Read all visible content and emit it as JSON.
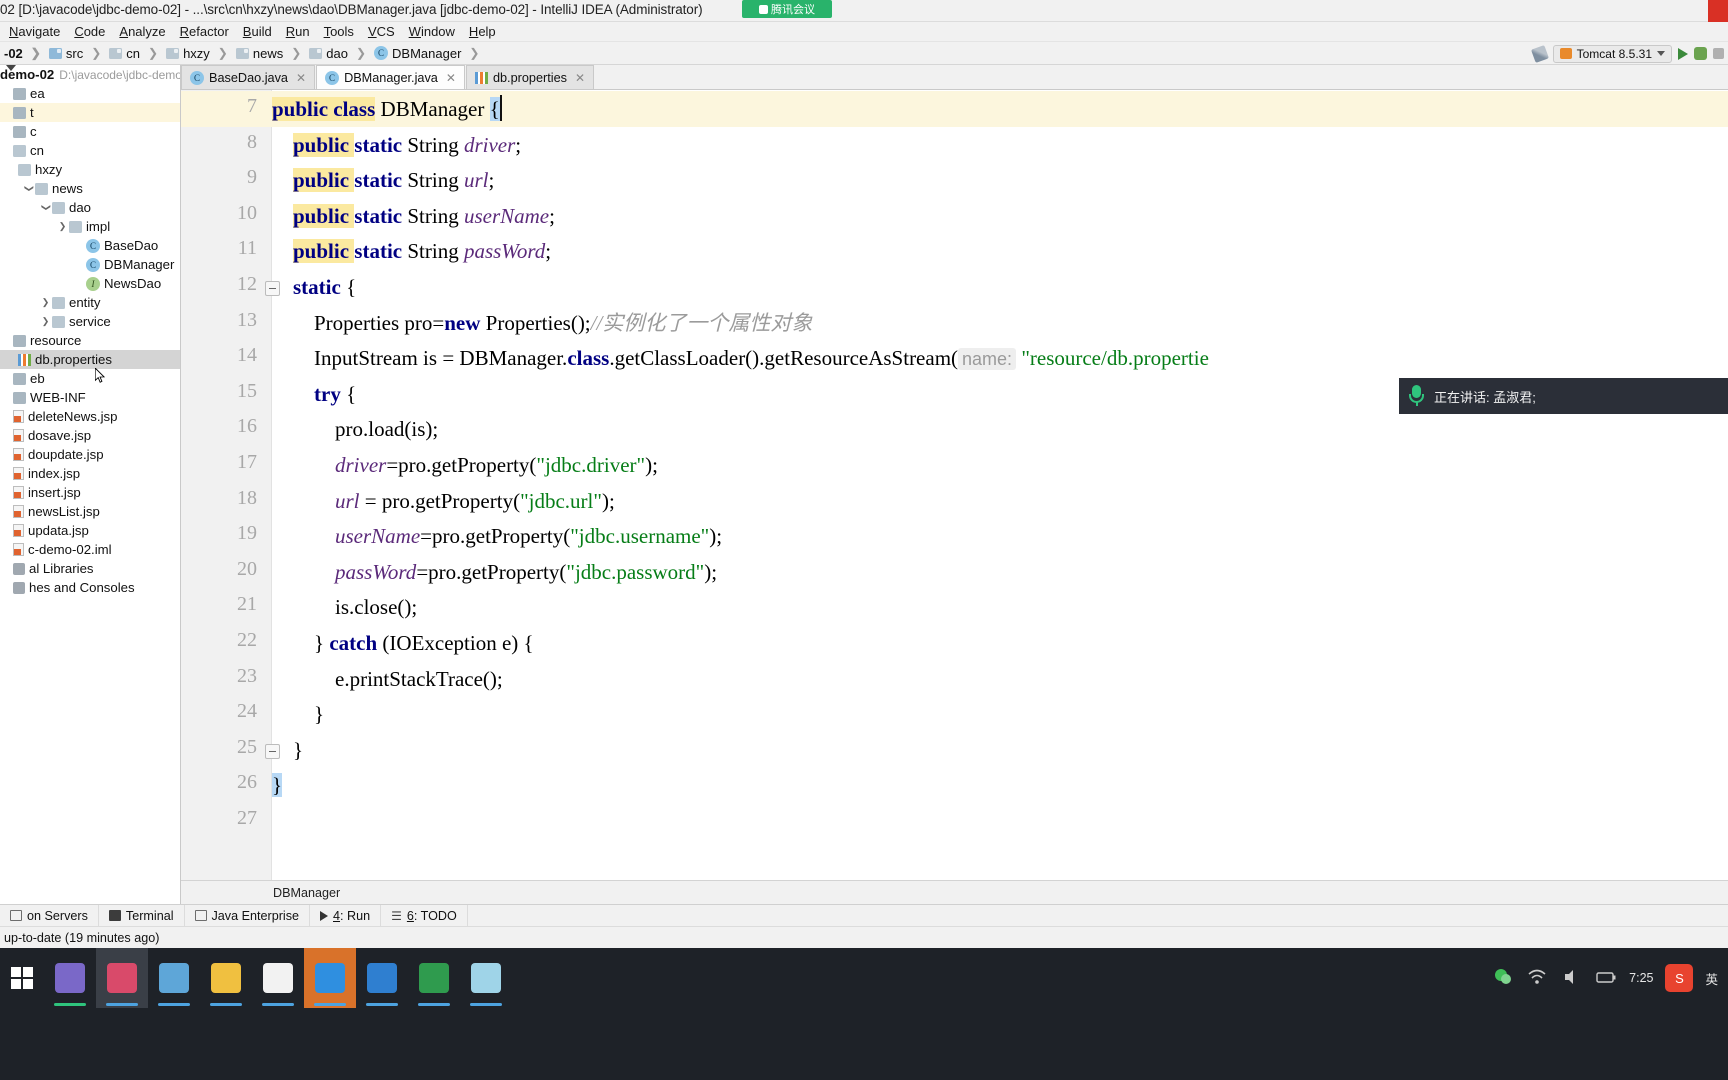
{
  "window": {
    "title": "02 [D:\\javacode\\jdbc-demo-02] - ...\\src\\cn\\hxzy\\news\\dao\\DBManager.java [jdbc-demo-02] - IntelliJ IDEA (Administrator)",
    "meeting_badge": "腾讯会议"
  },
  "menu": {
    "items": [
      "Navigate",
      "Code",
      "Analyze",
      "Refactor",
      "Build",
      "Run",
      "Tools",
      "VCS",
      "Window",
      "Help"
    ]
  },
  "breadcrumb": {
    "items": [
      {
        "label": "-02",
        "icon": "module-icon"
      },
      {
        "label": "src",
        "icon": "folder-icon"
      },
      {
        "label": "cn",
        "icon": "folder-icon"
      },
      {
        "label": "hxzy",
        "icon": "folder-icon"
      },
      {
        "label": "news",
        "icon": "folder-icon"
      },
      {
        "label": "dao",
        "icon": "folder-icon"
      },
      {
        "label": "DBManager",
        "icon": "class-icon"
      }
    ]
  },
  "run_toolbar": {
    "config_name": "Tomcat 8.5.31",
    "run_icon": "run-play-icon",
    "debug_icon": "debug-bug-icon",
    "build_icon": "build-hammer-icon",
    "stop_icon": "stop-icon",
    "search_icon": "search-everywhere-icon"
  },
  "project_tool": {
    "title_icons": [
      "locate-icon",
      "collapse-all-icon",
      "settings-gear-icon",
      "minimize-icon"
    ],
    "root": {
      "name": "demo-02",
      "path": "D:\\javacode\\jdbc-demo-"
    },
    "tree": [
      {
        "label": "ea",
        "depth": 0,
        "icon": "folder-icon",
        "twisty": "",
        "state": "none"
      },
      {
        "label": "t",
        "depth": 0,
        "icon": "folder-icon",
        "twisty": "",
        "state": "highlight"
      },
      {
        "label": "c",
        "depth": 0,
        "icon": "folder-icon",
        "twisty": "",
        "state": "none"
      },
      {
        "label": "cn",
        "depth": 0,
        "icon": "package-icon",
        "twisty": "",
        "state": "none"
      },
      {
        "label": "hxzy",
        "depth": 1,
        "icon": "package-icon",
        "twisty": "",
        "state": "none"
      },
      {
        "label": "news",
        "depth": 2,
        "icon": "package-icon",
        "twisty": "down",
        "state": "none"
      },
      {
        "label": "dao",
        "depth": 3,
        "icon": "package-icon",
        "twisty": "down",
        "state": "none"
      },
      {
        "label": "impl",
        "depth": 4,
        "icon": "package-icon",
        "twisty": "right",
        "state": "none"
      },
      {
        "label": "BaseDao",
        "depth": 5,
        "icon": "class-icon",
        "twisty": "",
        "state": "none"
      },
      {
        "label": "DBManager",
        "depth": 5,
        "icon": "class-icon",
        "twisty": "",
        "state": "none"
      },
      {
        "label": "NewsDao",
        "depth": 5,
        "icon": "interface-icon",
        "twisty": "",
        "state": "none"
      },
      {
        "label": "entity",
        "depth": 3,
        "icon": "package-icon",
        "twisty": "right",
        "state": "none"
      },
      {
        "label": "service",
        "depth": 3,
        "icon": "package-icon",
        "twisty": "right",
        "state": "none"
      },
      {
        "label": "resource",
        "depth": 0,
        "icon": "resource-icon",
        "twisty": "",
        "state": "none"
      },
      {
        "label": "db.properties",
        "depth": 1,
        "icon": "properties-icon",
        "twisty": "",
        "state": "selected"
      },
      {
        "label": "eb",
        "depth": 0,
        "icon": "folder-icon",
        "twisty": "",
        "state": "none"
      },
      {
        "label": "WEB-INF",
        "depth": 0,
        "icon": "folder-icon",
        "twisty": "",
        "state": "none"
      },
      {
        "label": "deleteNews.jsp",
        "depth": 0,
        "icon": "jsp-icon",
        "twisty": "",
        "state": "none"
      },
      {
        "label": "dosave.jsp",
        "depth": 0,
        "icon": "jsp-icon",
        "twisty": "",
        "state": "none"
      },
      {
        "label": "doupdate.jsp",
        "depth": 0,
        "icon": "jsp-icon",
        "twisty": "",
        "state": "none"
      },
      {
        "label": "index.jsp",
        "depth": 0,
        "icon": "jsp-icon",
        "twisty": "",
        "state": "none"
      },
      {
        "label": "insert.jsp",
        "depth": 0,
        "icon": "jsp-icon",
        "twisty": "",
        "state": "none"
      },
      {
        "label": "newsList.jsp",
        "depth": 0,
        "icon": "jsp-icon",
        "twisty": "",
        "state": "none"
      },
      {
        "label": "updata.jsp",
        "depth": 0,
        "icon": "jsp-icon",
        "twisty": "",
        "state": "none"
      },
      {
        "label": "c-demo-02.iml",
        "depth": 0,
        "icon": "iml-icon",
        "twisty": "",
        "state": "none"
      },
      {
        "label": "al Libraries",
        "depth": 0,
        "icon": "library-icon",
        "twisty": "",
        "state": "none"
      },
      {
        "label": "hes and Consoles",
        "depth": 0,
        "icon": "scratch-icon",
        "twisty": "",
        "state": "none"
      }
    ]
  },
  "editor_tabs": [
    {
      "label": "BaseDao.java",
      "icon": "class-icon",
      "active": false
    },
    {
      "label": "DBManager.java",
      "icon": "class-icon",
      "active": true
    },
    {
      "label": "db.properties",
      "icon": "properties-icon",
      "active": false
    }
  ],
  "editor": {
    "first_line": 7,
    "last_line": 27,
    "caret_line": 7,
    "breadcrumb": "DBManager",
    "lines": [
      {
        "n": 7,
        "segments": [
          {
            "t": "public",
            "c": "kw",
            "hl": true
          },
          {
            "t": " ",
            "c": "id",
            "hl": true
          },
          {
            "t": "class",
            "c": "kw",
            "hl": true
          },
          {
            "t": " ",
            "c": "id"
          },
          {
            "t": "DBManager",
            "c": "id"
          },
          {
            "t": " ",
            "c": "id"
          },
          {
            "t": "{",
            "c": "id",
            "sel": true
          }
        ],
        "caret": true,
        "fold": false
      },
      {
        "n": 8,
        "segments": [
          {
            "t": "    ",
            "c": "id"
          },
          {
            "t": "public",
            "c": "kw",
            "hl": true
          },
          {
            "t": " ",
            "c": "id",
            "hl": true
          },
          {
            "t": "static",
            "c": "kw"
          },
          {
            "t": " String ",
            "c": "id"
          },
          {
            "t": "driver",
            "c": "fld"
          },
          {
            "t": ";",
            "c": "id"
          }
        ]
      },
      {
        "n": 9,
        "segments": [
          {
            "t": "    ",
            "c": "id"
          },
          {
            "t": "public",
            "c": "kw",
            "hl": true
          },
          {
            "t": " ",
            "c": "id",
            "hl": true
          },
          {
            "t": "static",
            "c": "kw"
          },
          {
            "t": " String ",
            "c": "id"
          },
          {
            "t": "url",
            "c": "fld"
          },
          {
            "t": ";",
            "c": "id"
          }
        ]
      },
      {
        "n": 10,
        "segments": [
          {
            "t": "    ",
            "c": "id"
          },
          {
            "t": "public",
            "c": "kw",
            "hl": true
          },
          {
            "t": " ",
            "c": "id",
            "hl": true
          },
          {
            "t": "static",
            "c": "kw"
          },
          {
            "t": " String ",
            "c": "id"
          },
          {
            "t": "userName",
            "c": "fld"
          },
          {
            "t": ";",
            "c": "id"
          }
        ]
      },
      {
        "n": 11,
        "segments": [
          {
            "t": "    ",
            "c": "id"
          },
          {
            "t": "public",
            "c": "kw",
            "hl": true
          },
          {
            "t": " ",
            "c": "id",
            "hl": true
          },
          {
            "t": "static",
            "c": "kw"
          },
          {
            "t": " String ",
            "c": "id"
          },
          {
            "t": "passWord",
            "c": "fld"
          },
          {
            "t": ";",
            "c": "id"
          }
        ]
      },
      {
        "n": 12,
        "segments": [
          {
            "t": "    ",
            "c": "id"
          },
          {
            "t": "static",
            "c": "kw"
          },
          {
            "t": " {",
            "c": "id"
          }
        ],
        "fold": true
      },
      {
        "n": 13,
        "segments": [
          {
            "t": "        Properties pro=",
            "c": "id"
          },
          {
            "t": "new",
            "c": "kw"
          },
          {
            "t": " Properties();",
            "c": "id"
          },
          {
            "t": "//实例化了一个属性对象",
            "c": "cmt"
          }
        ]
      },
      {
        "n": 14,
        "segments": [
          {
            "t": "        InputStream is = DBManager.",
            "c": "id"
          },
          {
            "t": "class",
            "c": "kw"
          },
          {
            "t": ".getClassLoader().getResourceAsStream(",
            "c": "id"
          },
          {
            "t": "name:",
            "c": "hint"
          },
          {
            "t": " \"resource/db.propertie",
            "c": "str"
          }
        ]
      },
      {
        "n": 15,
        "segments": [
          {
            "t": "        ",
            "c": "id"
          },
          {
            "t": "try",
            "c": "kw"
          },
          {
            "t": " {",
            "c": "id"
          }
        ]
      },
      {
        "n": 16,
        "segments": [
          {
            "t": "            pro.load(is);",
            "c": "id"
          }
        ]
      },
      {
        "n": 17,
        "segments": [
          {
            "t": "            ",
            "c": "id"
          },
          {
            "t": "driver",
            "c": "fld"
          },
          {
            "t": "=pro.getProperty(",
            "c": "id"
          },
          {
            "t": "\"jdbc.driver\"",
            "c": "str"
          },
          {
            "t": ");",
            "c": "id"
          }
        ]
      },
      {
        "n": 18,
        "segments": [
          {
            "t": "            ",
            "c": "id"
          },
          {
            "t": "url",
            "c": "fld"
          },
          {
            "t": " = pro.getProperty(",
            "c": "id"
          },
          {
            "t": "\"jdbc.url\"",
            "c": "str"
          },
          {
            "t": ");",
            "c": "id"
          }
        ]
      },
      {
        "n": 19,
        "segments": [
          {
            "t": "            ",
            "c": "id"
          },
          {
            "t": "userName",
            "c": "fld"
          },
          {
            "t": "=pro.getProperty(",
            "c": "id"
          },
          {
            "t": "\"jdbc.username\"",
            "c": "str"
          },
          {
            "t": ");",
            "c": "id"
          }
        ]
      },
      {
        "n": 20,
        "segments": [
          {
            "t": "            ",
            "c": "id"
          },
          {
            "t": "passWord",
            "c": "fld"
          },
          {
            "t": "=pro.getProperty(",
            "c": "id"
          },
          {
            "t": "\"jdbc.password\"",
            "c": "str"
          },
          {
            "t": ");",
            "c": "id"
          }
        ]
      },
      {
        "n": 21,
        "segments": [
          {
            "t": "            is.close();",
            "c": "id"
          }
        ]
      },
      {
        "n": 22,
        "segments": [
          {
            "t": "        } ",
            "c": "id"
          },
          {
            "t": "catch",
            "c": "kw"
          },
          {
            "t": " (IOException e) {",
            "c": "id"
          }
        ]
      },
      {
        "n": 23,
        "segments": [
          {
            "t": "            e.printStackTrace();",
            "c": "id"
          }
        ]
      },
      {
        "n": 24,
        "segments": [
          {
            "t": "        }",
            "c": "id"
          }
        ]
      },
      {
        "n": 25,
        "segments": [
          {
            "t": "    }",
            "c": "id"
          }
        ],
        "fold": true
      },
      {
        "n": 26,
        "segments": [
          {
            "t": "}",
            "c": "id",
            "sel": true
          }
        ]
      },
      {
        "n": 27,
        "segments": [
          {
            "t": "",
            "c": "id"
          }
        ]
      }
    ]
  },
  "toast": {
    "icon": "microphone-icon",
    "text": "正在讲话: 孟淑君;"
  },
  "bottom_tools": [
    {
      "label": "on Servers",
      "icon": "app-servers-icon"
    },
    {
      "label": "Terminal",
      "icon": "terminal-icon"
    },
    {
      "label": "Java Enterprise",
      "icon": "java-enterprise-icon"
    },
    {
      "label": "4: Run",
      "icon": "run-icon"
    },
    {
      "label": "6: TODO",
      "icon": "todo-icon"
    }
  ],
  "status": {
    "message": "up-to-date (19 minutes ago)"
  },
  "taskbar": {
    "clock": "7:25",
    "ime": "英",
    "apps": [
      {
        "name": "dolphin-app",
        "color": "#7a68c8"
      },
      {
        "name": "intellij-idea",
        "color": "#d94a6a"
      },
      {
        "name": "paint-app",
        "color": "#5ea6d8"
      },
      {
        "name": "file-explorer",
        "color": "#f0c040"
      },
      {
        "name": "typora-app",
        "color": "#f2f2f2"
      },
      {
        "name": "tencent-meeting",
        "color": "#2f8fe0"
      },
      {
        "name": "navicat-app",
        "color": "#2f7fd0"
      },
      {
        "name": "hbuilder-app",
        "color": "#2f9b4e"
      },
      {
        "name": "notes-app",
        "color": "#9fd4e8"
      }
    ]
  }
}
